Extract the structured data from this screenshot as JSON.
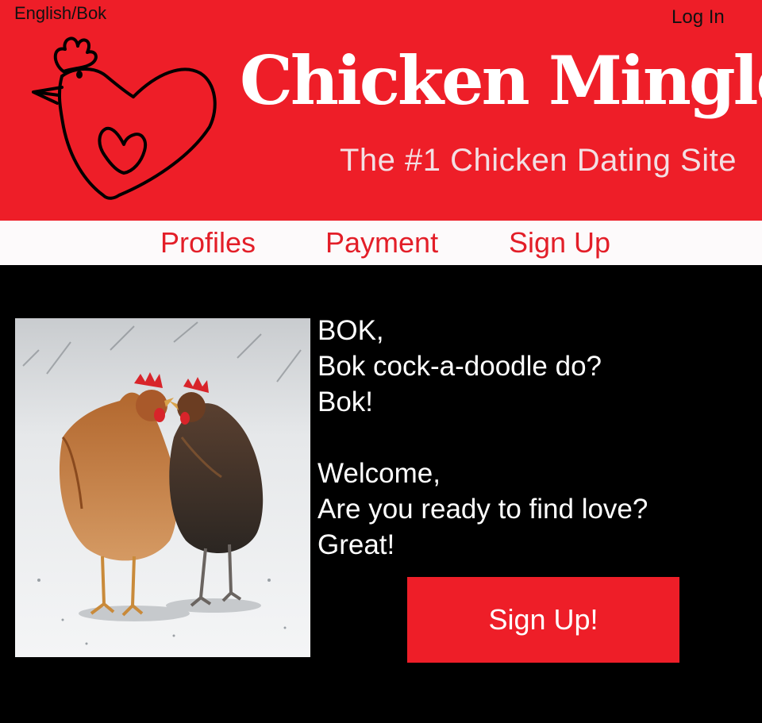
{
  "header": {
    "language_toggle": "English/Bok",
    "login_label": "Log In",
    "site_title": "Chicken Mingle",
    "tagline": "The #1 Chicken Dating Site",
    "logo_icon": "chicken-heart-logo-icon"
  },
  "nav": {
    "items": [
      {
        "label": "Profiles"
      },
      {
        "label": "Payment"
      },
      {
        "label": "Sign Up"
      }
    ]
  },
  "main": {
    "photo_description_icon": "two-chickens-photo",
    "intro_lines": [
      "BOK,",
      "Bok cock-a-doodle do?",
      "Bok!",
      "",
      "Welcome,",
      "Are you ready to find love?",
      "Great!"
    ],
    "cta_label": "Sign Up!"
  },
  "colors": {
    "brand_red": "#ee1e28",
    "nav_background": "#fdfafb",
    "page_background": "#000000",
    "tagline": "#f3dfe3"
  }
}
